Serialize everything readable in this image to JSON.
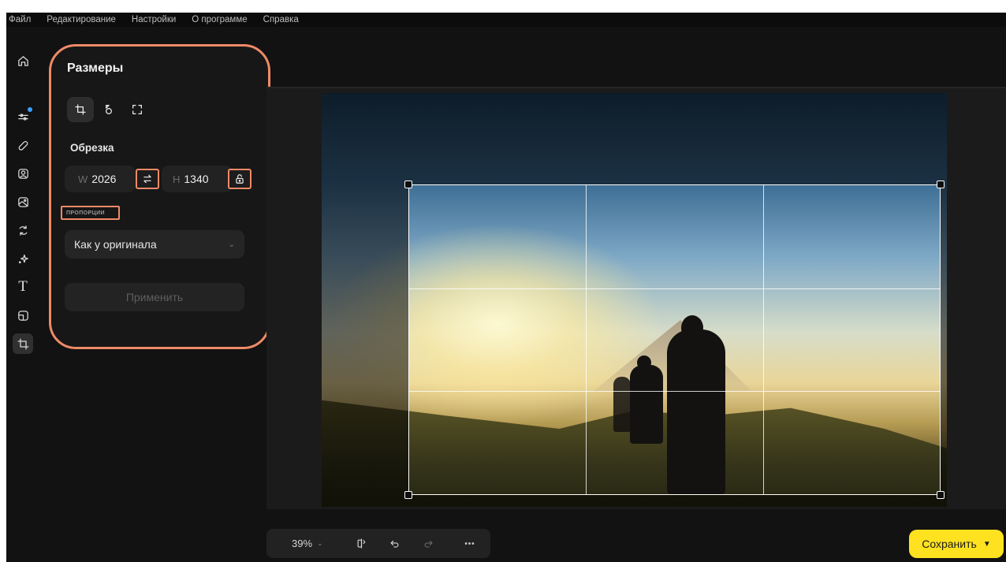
{
  "menu": [
    "Файл",
    "Редактирование",
    "Настройки",
    "О программе",
    "Справка"
  ],
  "toolbar": {
    "tools": [
      "home-icon",
      "adjustments-icon",
      "retouch-icon",
      "portrait-icon",
      "background-icon",
      "replace-icon",
      "effects-icon",
      "text-icon",
      "frame-icon",
      "crop-icon"
    ],
    "text_tool_glyph": "T",
    "active_tool": "crop-icon",
    "notification_color": "#3aa0ff"
  },
  "panel": {
    "title": "Размеры",
    "modes": [
      "crop-mode-icon",
      "rotate-mode-icon",
      "resize-mode-icon"
    ],
    "crop_section": "Обрезка",
    "width_prefix": "W",
    "width": "2026",
    "height_prefix": "H",
    "height": "1340",
    "proportions_label": "ПРОПОРЦИИ",
    "proportions_value": "Как у оригинала",
    "apply_label": "Применить",
    "highlight_color": "#ef8a67"
  },
  "bottom": {
    "zoom": "39%",
    "save_label": "Сохранить",
    "save_color": "#ffe21f"
  }
}
